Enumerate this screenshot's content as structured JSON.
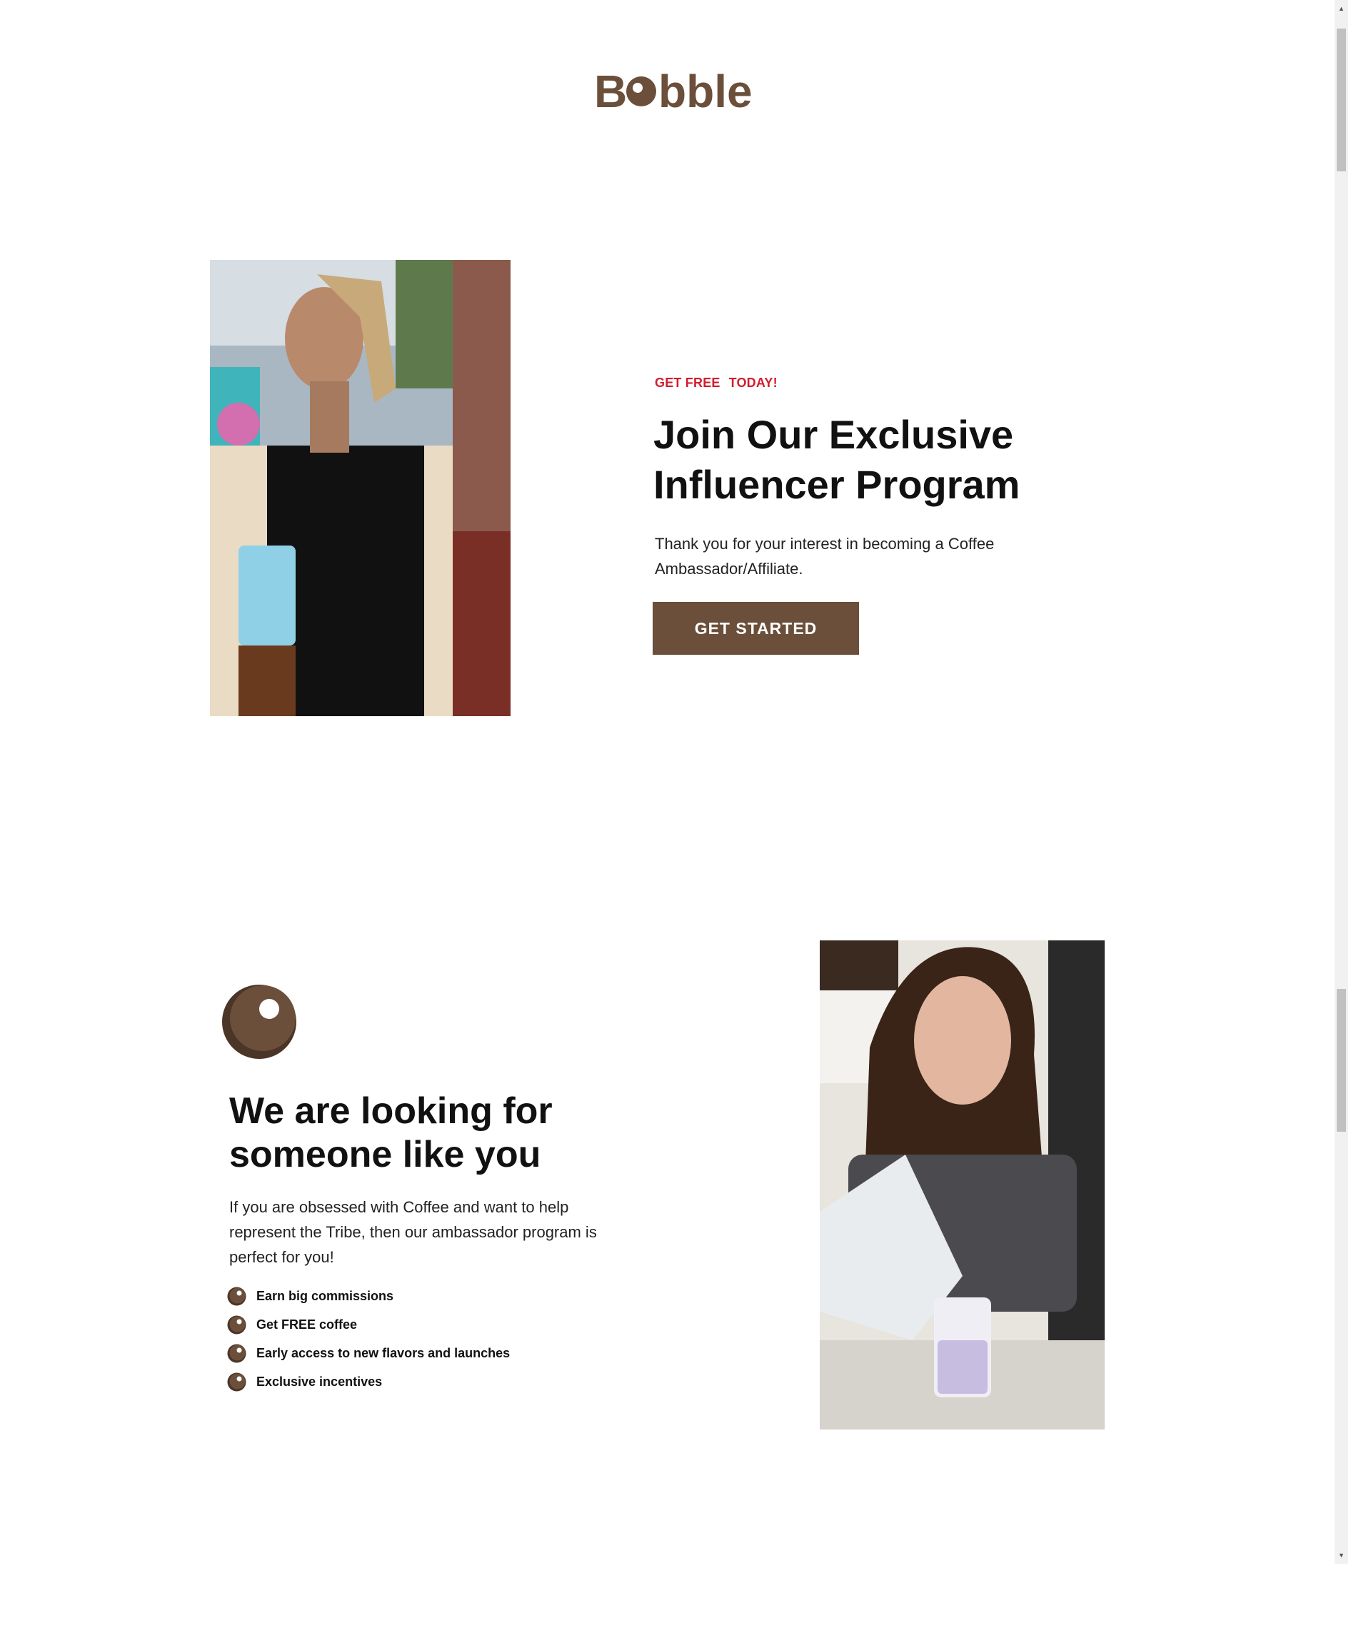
{
  "brand": {
    "logo_text": "Bobble",
    "color": "#6b4f3a"
  },
  "hero": {
    "tagline_part1": "GET FREE",
    "tagline_part2": "TODAY!",
    "title": "Join Our Exclusive Influencer Program",
    "text": "Thank you for your interest in becoming a Coffee Ambassador/Affiliate.",
    "cta_label": "GET STARTED"
  },
  "section2": {
    "title": "We are looking for someone like you",
    "text": "If you are obsessed with Coffee and want to help represent the Tribe, then our ambassador program is perfect for you!",
    "bullets": [
      "Earn big commissions",
      "Get FREE coffee",
      "Early access to new flavors and launches",
      "Exclusive incentives"
    ]
  },
  "colors": {
    "accent_red": "#d01f2e",
    "button_brown": "#6b4f3a",
    "text_dark": "#111111"
  },
  "icons": {
    "scroll_up": "▲",
    "scroll_down": "▼",
    "bubble": "bubble-icon"
  }
}
